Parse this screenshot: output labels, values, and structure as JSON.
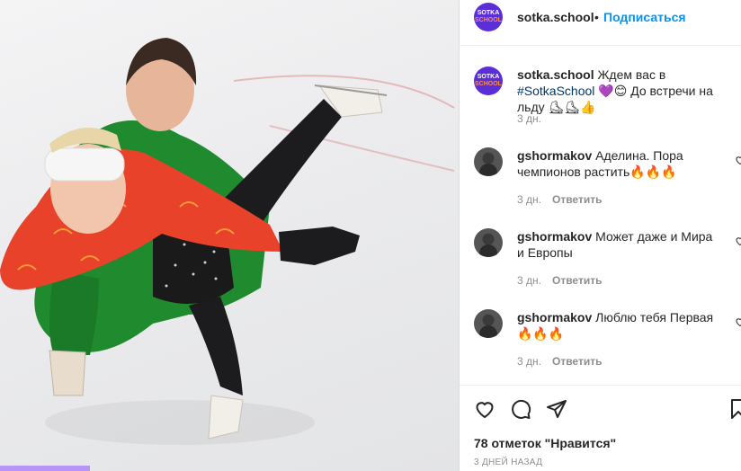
{
  "post": {
    "photo_alt": "",
    "header": {
      "avatar_text_line1": "SOTKA",
      "avatar_text_line2": "SCHOOL",
      "username": "sotka.school",
      "separator": "•",
      "follow_label": "Подписаться"
    },
    "caption": {
      "username": "sotka.school",
      "text_before": "Ждем вас в ",
      "hashtag": "#SotkaSchool",
      "text_after": "💜😊 До встречи на льду ⛸⛸👍",
      "time": "3 дн."
    },
    "comments": [
      {
        "username": "gshormakov",
        "text": "Аделина. Пора чемпионов растить🔥🔥🔥",
        "time": "3 дн.",
        "reply_label": "Ответить"
      },
      {
        "username": "gshormakov",
        "text": "Может даже и Мира и Европы",
        "time": "3 дн.",
        "reply_label": "Ответить"
      },
      {
        "username": "gshormakov",
        "text": "Люблю тебя Первая 🔥🔥🔥",
        "time": "3 дн.",
        "reply_label": "Ответить"
      }
    ],
    "likes_text": "78 отметок \"Нравится\"",
    "date_text": "3 ДНЕЙ НАЗАД"
  },
  "icons": {
    "like": "heart-icon",
    "comment": "comment-icon",
    "share": "paper-plane-icon",
    "save": "bookmark-icon",
    "comment_like": "heart-icon"
  },
  "colors": {
    "accent": "#0095f6",
    "avatar_bg": "#5a2fd8",
    "hashtag": "#00376b"
  }
}
